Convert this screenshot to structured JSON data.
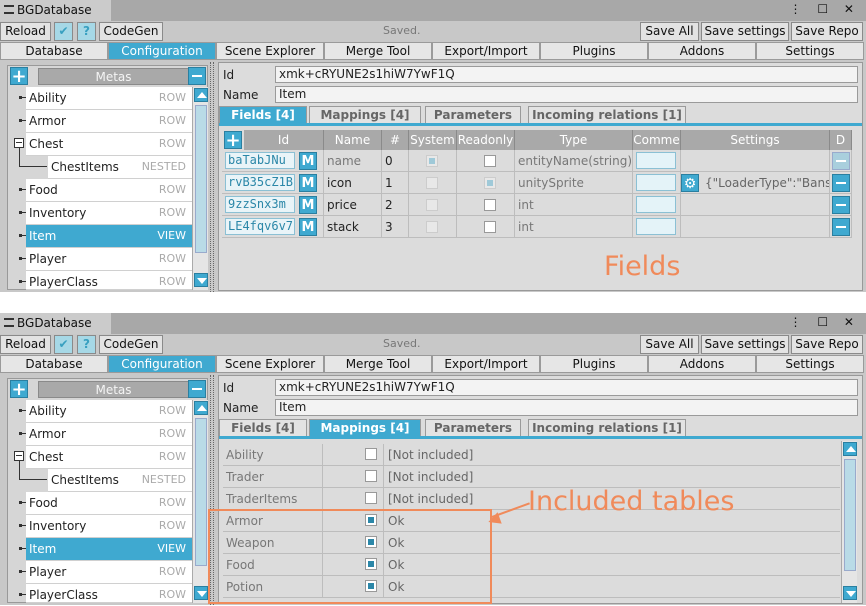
{
  "window": {
    "title": "BGDatabase",
    "icons": "⋮ ☐ ✕"
  },
  "toolbar": {
    "reload": "Reload",
    "codegen": "CodeGen",
    "status": "Saved.",
    "save_all": "Save All",
    "save_settings": "Save settings",
    "save_repo": "Save Repo"
  },
  "nav": [
    "Database",
    "Configuration",
    "Scene Explorer",
    "Merge Tool",
    "Export/Import",
    "Plugins",
    "Addons",
    "Settings"
  ],
  "metas": {
    "header": "Metas",
    "items": [
      {
        "name": "Ability",
        "type": "ROW"
      },
      {
        "name": "Armor",
        "type": "ROW"
      },
      {
        "name": "Chest",
        "type": "ROW"
      },
      {
        "name": "ChestItems",
        "type": "NESTED"
      },
      {
        "name": "Food",
        "type": "ROW"
      },
      {
        "name": "Inventory",
        "type": "ROW"
      },
      {
        "name": "Item",
        "type": "VIEW"
      },
      {
        "name": "Player",
        "type": "ROW"
      },
      {
        "name": "PlayerClass",
        "type": "ROW"
      }
    ]
  },
  "detail": {
    "id_label": "Id",
    "id_value": "xmk+cRYUNE2s1hiW7YwF1Q",
    "name_label": "Name",
    "name_value": "Item"
  },
  "subtabs": [
    "Fields [4]",
    "Mappings [4]",
    "Parameters",
    "Incoming relations [1]"
  ],
  "fields_grid": {
    "headers": [
      "Id",
      "Name",
      "#",
      "System",
      "Readonly",
      "Type",
      "Comme",
      "Settings",
      "D"
    ],
    "rows": [
      {
        "id": "baTabJNu",
        "m": "M",
        "name": "name",
        "num": "0",
        "type": "entityName(string)",
        "settings": ""
      },
      {
        "id": "rvB35cZ1B",
        "m": "M",
        "name": "icon",
        "num": "1",
        "type": "unitySprite",
        "settings": "{\"LoaderType\":\"Bansl"
      },
      {
        "id": "9zzSnx3m",
        "m": "M",
        "name": "price",
        "num": "2",
        "type": "int",
        "settings": ""
      },
      {
        "id": "LE4fqv6v7",
        "m": "M",
        "name": "stack",
        "num": "3",
        "type": "int",
        "settings": ""
      }
    ]
  },
  "mappings": [
    {
      "name": "Ability",
      "checked": false,
      "status": "[Not included]"
    },
    {
      "name": "Trader",
      "checked": false,
      "status": "[Not included]"
    },
    {
      "name": "TraderItems",
      "checked": false,
      "status": "[Not included]"
    },
    {
      "name": "Armor",
      "checked": true,
      "status": "Ok"
    },
    {
      "name": "Weapon",
      "checked": true,
      "status": "Ok"
    },
    {
      "name": "Food",
      "checked": true,
      "status": "Ok"
    },
    {
      "name": "Potion",
      "checked": true,
      "status": "Ok"
    }
  ],
  "annotations": {
    "fields": "Fields",
    "included": "Included tables"
  },
  "colors": {
    "accent": "#3fa9d0",
    "annotation": "#f08a5a"
  }
}
